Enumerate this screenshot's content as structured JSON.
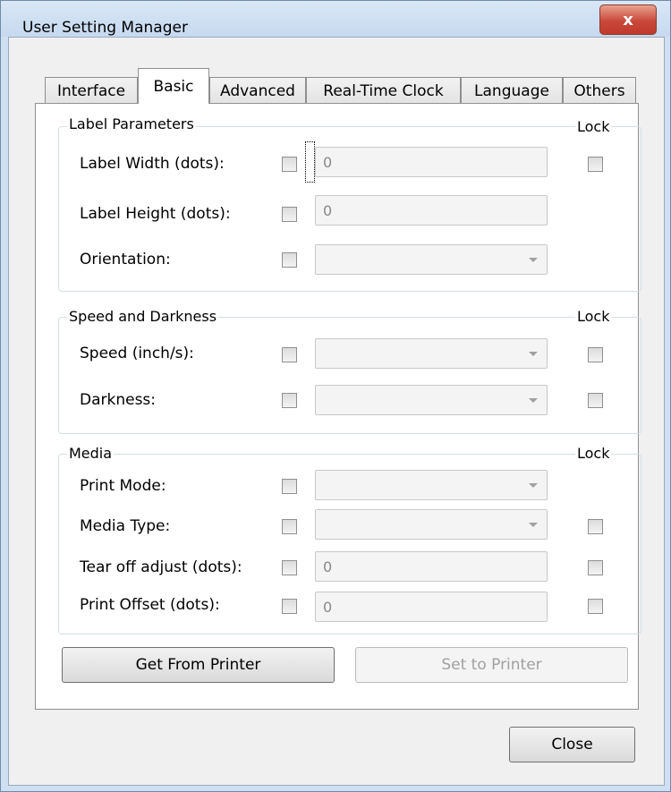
{
  "window": {
    "title": "User Setting Manager",
    "close_glyph": "x"
  },
  "tabs": [
    "Interface",
    "Basic",
    "Advanced",
    "Real-Time Clock",
    "Language",
    "Others"
  ],
  "active_tab": "Basic",
  "label_parameters": {
    "title": "Label Parameters",
    "lock_title": "Lock",
    "label_width": {
      "label": "Label Width (dots):",
      "value": "0"
    },
    "label_height": {
      "label": "Label Height (dots):",
      "value": "0"
    },
    "orientation": {
      "label": "Orientation:",
      "value": ""
    }
  },
  "speed_darkness": {
    "title": "Speed and Darkness",
    "lock_title": "Lock",
    "speed": {
      "label": "Speed (inch/s):",
      "value": ""
    },
    "darkness": {
      "label": "Darkness:",
      "value": ""
    }
  },
  "media": {
    "title": "Media",
    "lock_title": "Lock",
    "print_mode": {
      "label": "Print Mode:",
      "value": ""
    },
    "media_type": {
      "label": "Media Type:",
      "value": ""
    },
    "tear_off": {
      "label": "Tear off adjust (dots):",
      "value": "0"
    },
    "print_offset": {
      "label": "Print Offset (dots):",
      "value": "0"
    }
  },
  "buttons": {
    "get_from_printer": "Get From Printer",
    "set_to_printer": "Set to Printer",
    "close": "Close"
  },
  "icons": {
    "close_icon": "close-icon",
    "dropdown_icon": "chevron-down-icon"
  }
}
